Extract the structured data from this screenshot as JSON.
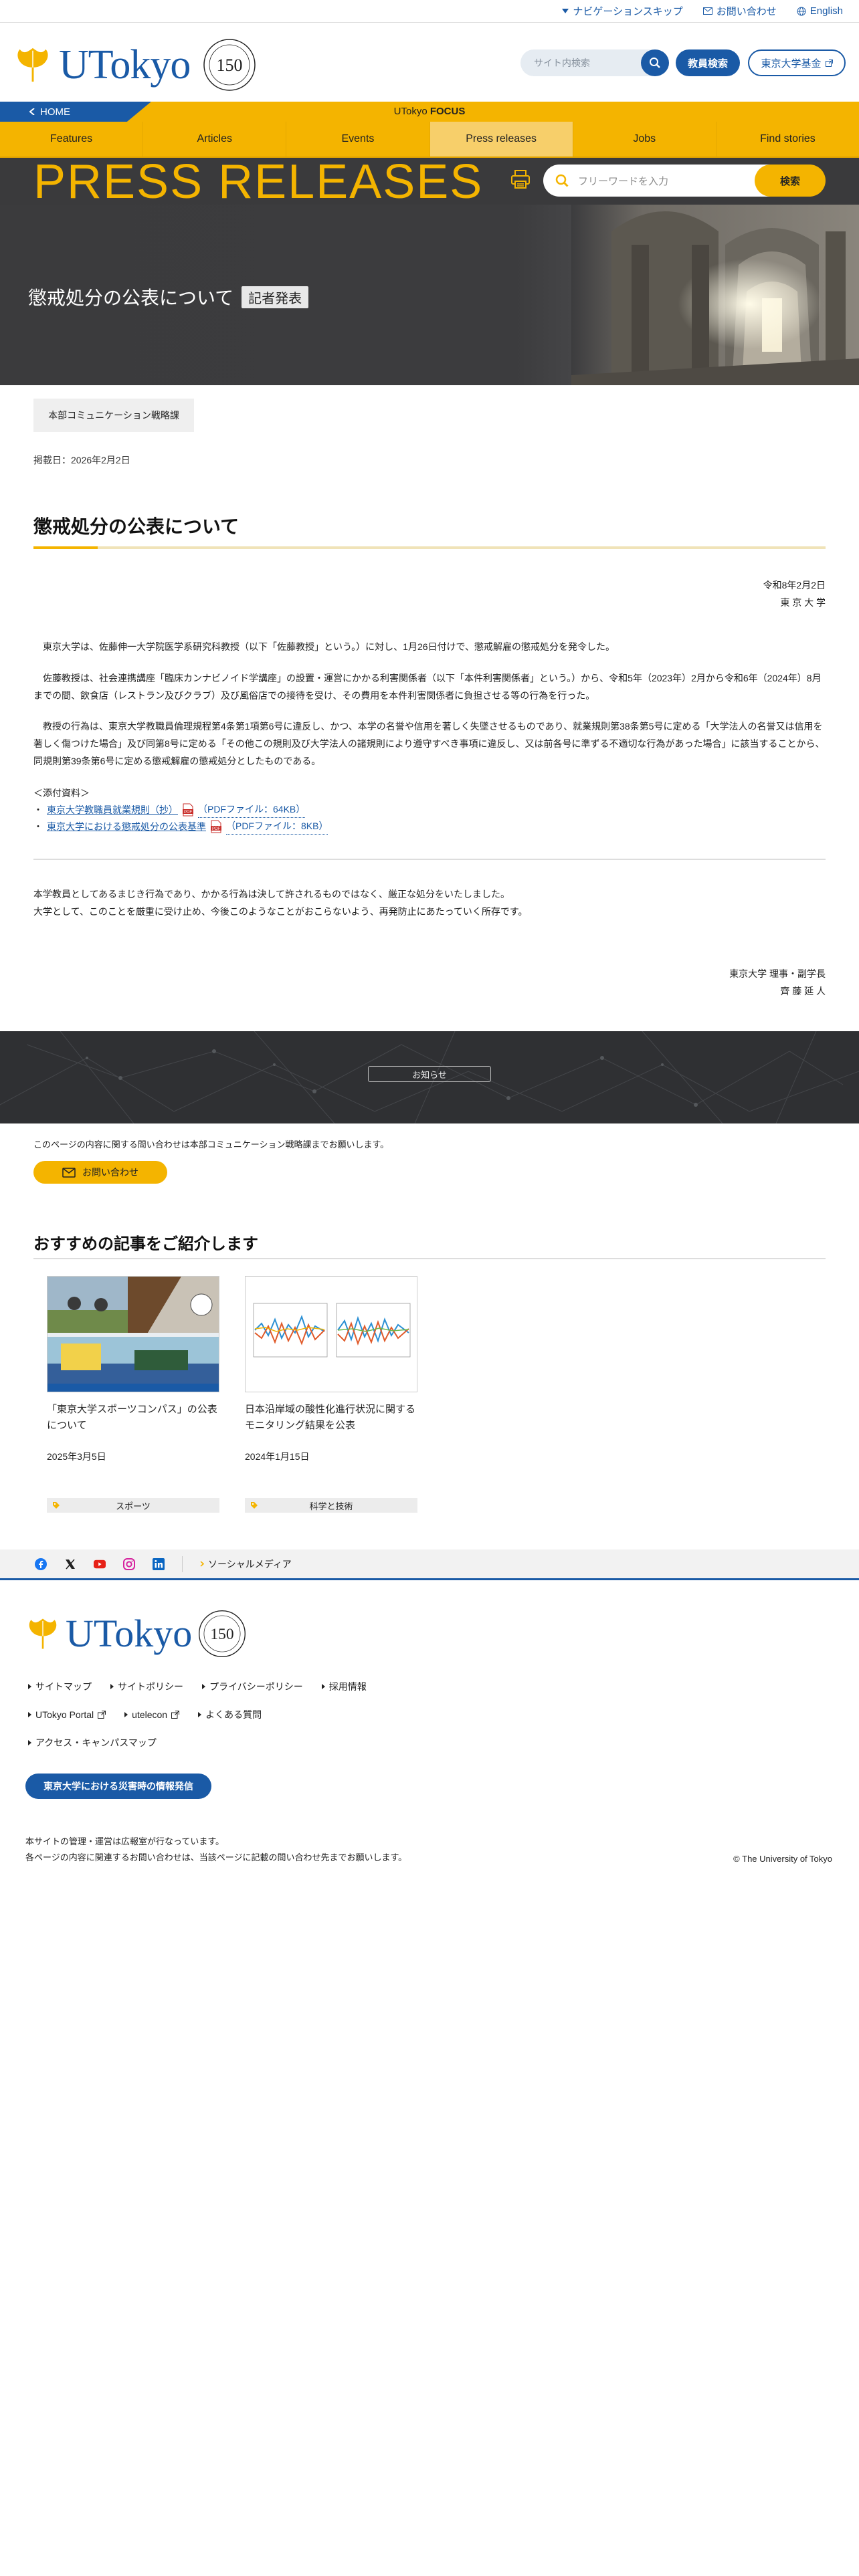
{
  "utility": {
    "skip_nav": "ナビゲーションスキップ",
    "contact": "お問い合わせ",
    "english": "English"
  },
  "header": {
    "logo_text": "UTokyo",
    "search_placeholder": "サイト内検索",
    "faculty_search": "教員検索",
    "fund": "東京大学基金"
  },
  "focus": {
    "home": "HOME",
    "label_prefix": "UTokyo",
    "label_bold": "FOCUS"
  },
  "nav": {
    "items": [
      "Features",
      "Articles",
      "Events",
      "Press releases",
      "Jobs",
      "Find stories"
    ],
    "active_index": 3
  },
  "press": {
    "title": "PRESS RELEASES",
    "search_placeholder": "フリーワードを入力",
    "search_button": "検索"
  },
  "hero": {
    "title": "懲戒処分の公表について",
    "badge": "記者発表"
  },
  "article": {
    "department": "本部コミュニケーション戦略課",
    "posted": "掲載日：2026年2月2日",
    "title": "懲戒処分の公表について",
    "date_line": "令和8年2月2日",
    "org_line": "東 京 大 学",
    "para1": "東京大学は、佐藤伸一大学院医学系研究科教授（以下「佐藤教授」という。）に対し、1月26日付けで、懲戒解雇の懲戒処分を発令した。",
    "para2": "佐藤教授は、社会連携講座「臨床カンナビノイド学講座」の設置・運営にかかる利害関係者（以下「本件利害関係者」という。）から、令和5年（2023年）2月から令和6年（2024年）8月までの間、飲食店（レストラン及びクラブ）及び風俗店での接待を受け、その費用を本件利害関係者に負担させる等の行為を行った。",
    "para3": "教授の行為は、東京大学教職員倫理規程第4条第1項第6号に違反し、かつ、本学の名誉や信用を著しく失墜させるものであり、就業規則第38条第5号に定める「大学法人の名誉又は信用を著しく傷つけた場合」及び同第8号に定める「その他この規則及び大学法人の諸規則により遵守すべき事項に違反し、又は前各号に準ずる不適切な行為があった場合」に該当することから、同規則第39条第6号に定める懲戒解雇の懲戒処分としたものである。",
    "attach_label": "＜添付資料＞",
    "attachments": [
      {
        "bullet": "・",
        "name": "東京大学教職員就業規則（抄）",
        "info": "（PDFファイル：64KB）"
      },
      {
        "bullet": "・",
        "name": "東京大学における懲戒処分の公表基準",
        "info": "（PDFファイル：8KB）"
      }
    ],
    "closing1": "本学教員としてあるまじき行為であり、かかる行為は決して許されるものではなく、厳正な処分をいたしました。",
    "closing2": "大学として、このことを厳重に受け止め、今後このようなことがおこらないよう、再発防止にあたっていく所存です。",
    "signer_title": "東京大学 理事・副学長",
    "signer_name": "齊 藤 延 人"
  },
  "notice": {
    "button": "お知らせ",
    "contact_text": "このページの内容に関する問い合わせは本部コミュニケーション戦略課までお願いします。",
    "contact_button": "お問い合わせ"
  },
  "recommended": {
    "title": "おすすめの記事をご紹介します",
    "cards": [
      {
        "title": "「東京大学スポーツコンパス」の公表について",
        "date": "2025年3月5日",
        "category": "スポーツ"
      },
      {
        "title": "日本沿岸域の酸性化進行状況に関するモニタリング結果を公表",
        "date": "2024年1月15日",
        "category": "科学と技術"
      }
    ]
  },
  "social": {
    "label": "ソーシャルメディア",
    "icons": [
      "facebook-icon",
      "x-icon",
      "youtube-icon",
      "instagram-icon",
      "linkedin-icon"
    ]
  },
  "footer": {
    "logo_text": "UTokyo",
    "links_row1": [
      "サイトマップ",
      "サイトポリシー",
      "プライバシーポリシー",
      "採用情報"
    ],
    "links_row2": [
      "UTokyo Portal",
      "utelecon",
      "よくある質問"
    ],
    "links_row3": [
      "アクセス・キャンパスマップ"
    ],
    "disaster": "東京大学における災害時の情報発信",
    "note1": "本サイトの管理・運営は広報室が行なっています。",
    "note2": "各ページの内容に関連するお問い合わせは、当該ページに記載の問い合わせ先までお願いします。",
    "copyright": "© The University of Tokyo"
  },
  "colors": {
    "brand_blue": "#1a5aa6",
    "brand_yellow": "#f4b400",
    "dark": "#3a3a3c"
  }
}
